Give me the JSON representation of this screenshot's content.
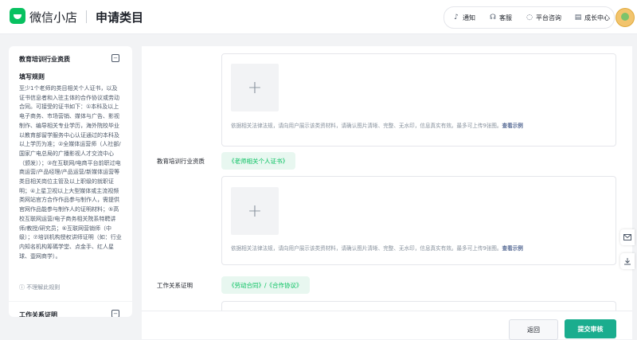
{
  "header": {
    "brand": "微信小店",
    "page_title": "申请类目",
    "nav": [
      {
        "label": "通知",
        "icon": "bell-icon",
        "glyph": "🔔"
      },
      {
        "label": "客服",
        "icon": "headset-icon",
        "glyph": "☊"
      },
      {
        "label": "平台咨询",
        "icon": "chat-icon",
        "glyph": "◌"
      },
      {
        "label": "成长中心",
        "icon": "document-icon",
        "glyph": "▤"
      }
    ]
  },
  "sidebar": {
    "title": "教育培训行业资质",
    "rule_title": "填写规则",
    "rule_text": "至少1个老师的类目相关个人证书，以及证书信息者和入驻主体的合作协议或劳动合同。可接受的证书如下：①本科及以上电子商务、市场营销、媒体与广告、影视制作、编导相关专业学历，海外院校毕业以教育部留学服务中心认证通过的本科及以上学历为准；②全媒体运营师（人社部/国家广电总局的广播影视人才交流中心（颁发））；③在互联网/电商平台前职过电商运营/产品经理/产品运营/新媒体运营等类目相关岗位主管及以上职级的就职证明；④上星卫视以上大型媒体或主流视频类网站官方合作作品参与制作人，需提供官网作品能参与制作人的证明材料；⑤高校互联网运营/电子商务相关院系特聘讲师/教授/研究员；⑥互联网营销师（中级）；⑦培训机构授权讲师证明（如：行业内知名机构筹碼学堂、点金手、红人星球、壹网商学）。",
    "not_understand": "不理解此规则",
    "next_section": "工作关系证明"
  },
  "sections": {
    "card1": {
      "hint": "依据相关法律法规，请向用户展示该类资材料，请确认图片清晰、完整、无水印，信息真实有效。最多可上传9张图。",
      "link": "查看示例"
    },
    "cert": {
      "label": "教育培训行业资质",
      "tag": "《老师相关个人证书》"
    },
    "card2": {
      "hint": "依据相关法律法规，请向用户展示该类资材料，请确认图片清晰、完整、无水印，信息真实有效。最多可上传9张图。",
      "link": "查看示例"
    },
    "work": {
      "label": "工作关系证明",
      "tag": "《劳动合同》/《合作协议》"
    }
  },
  "footer": {
    "back": "返回",
    "submit": "提交审核"
  },
  "colors": {
    "accent": "#07c160",
    "submit": "#1aad8e",
    "link": "#576b95"
  }
}
